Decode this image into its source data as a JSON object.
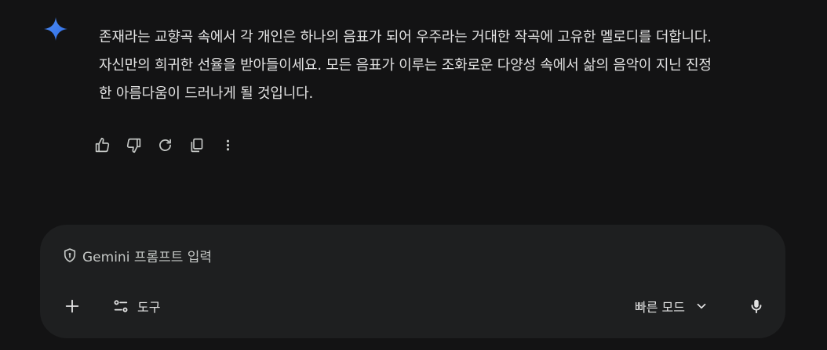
{
  "response": {
    "lines": [
      "존재라는 교향곡 속에서 각 개인은 하나의 음표가 되어 우주라는 거대한 작곡에 고유한 멜로디를 더합니다.",
      "자신만의 희귀한 선율을 받아들이세요. 모든 음표가 이루는 조화로운 다양성 속에서 삶의 음악이 지닌 진정",
      "한 아름다움이 드러나게 될 것입니다."
    ]
  },
  "actions": {
    "icons": [
      "thumbs-up-icon",
      "thumbs-down-icon",
      "regenerate-icon",
      "copy-icon",
      "more-vert-icon"
    ]
  },
  "composer": {
    "placeholder": "Gemini 프롬프트 입력",
    "tools_label": "도구",
    "mode_label": "빠른 모드"
  },
  "colors": {
    "background": "#131314",
    "composer_bg": "#1e1f20",
    "text": "#e3e3e3",
    "muted": "#c4c7c5",
    "sparkle": "#4796e3"
  }
}
